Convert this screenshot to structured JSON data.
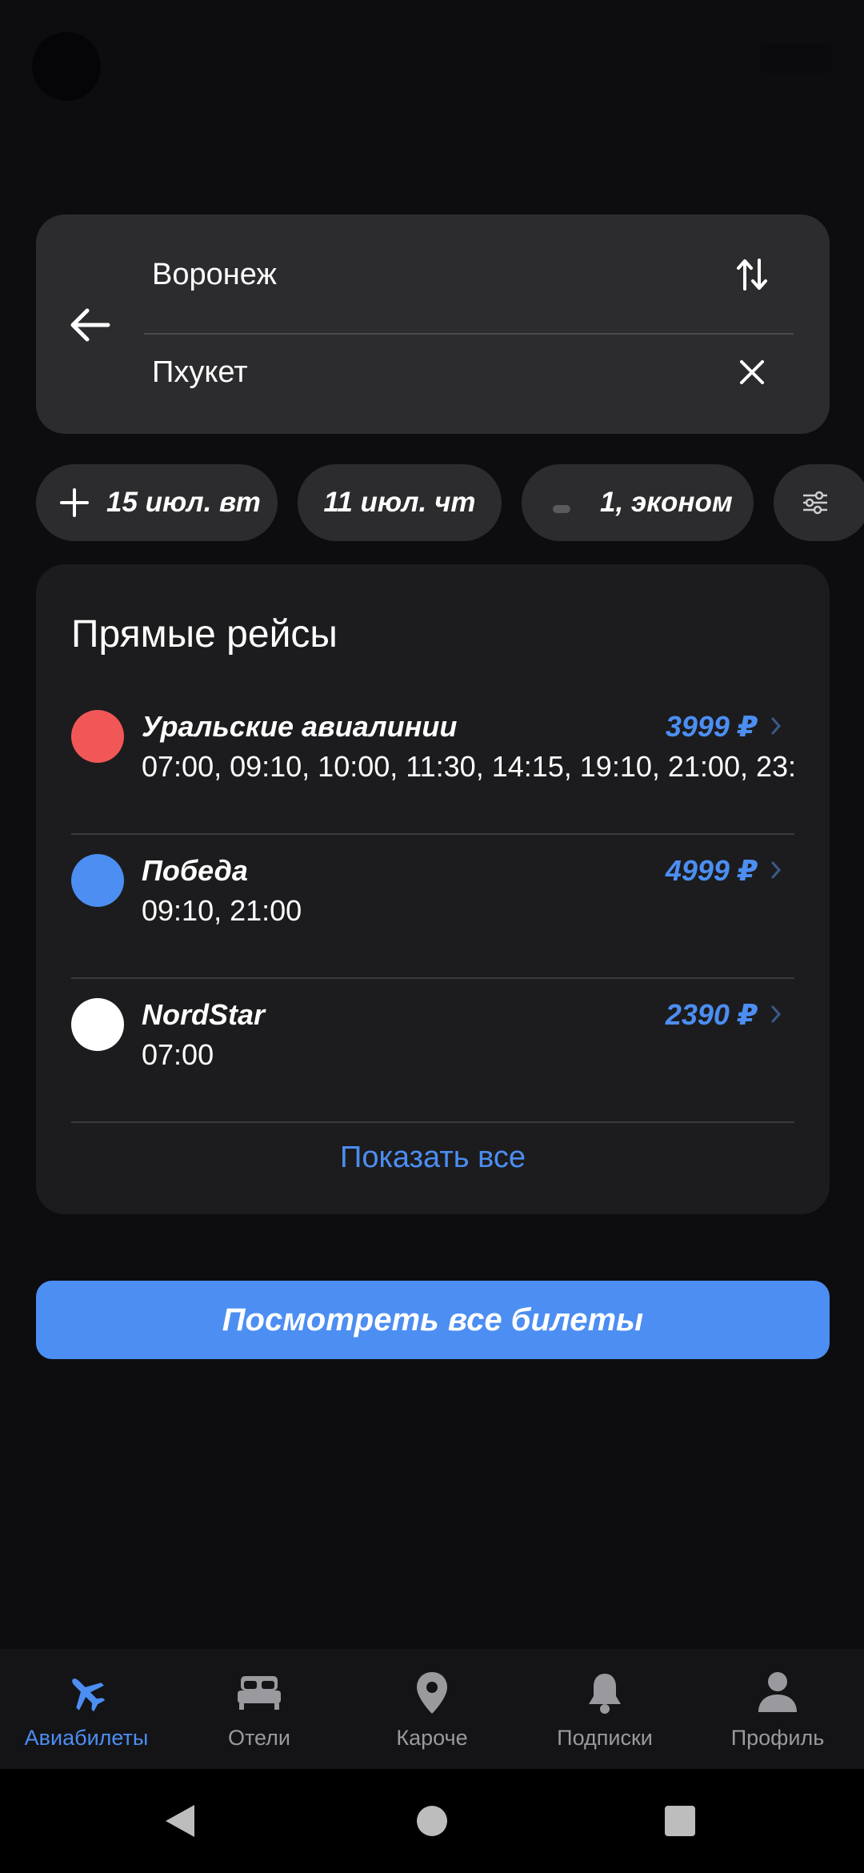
{
  "search": {
    "from": "Воронеж",
    "to": "Пхукет"
  },
  "chips": {
    "date_forward": "15 июл. вт",
    "date_return": "11 июл. чт",
    "passengers": "1, эконом"
  },
  "direct_flights": {
    "title": "Прямые рейсы",
    "rows": [
      {
        "airline": "Уральские авиалинии",
        "times": "07:00, 09:10, 10:00, 11:30, 14:15, 19:10, 21:00, 23:",
        "price": "3999 ₽",
        "color": "#f25757"
      },
      {
        "airline": "Победа",
        "times": "09:10, 21:00",
        "price": "4999 ₽",
        "color": "#4c8ef2"
      },
      {
        "airline": "NordStar",
        "times": "07:00",
        "price": "2390 ₽",
        "color": "#ffffff"
      }
    ],
    "show_all": "Показать все"
  },
  "main_button": "Посмотреть все билеты",
  "nav": {
    "items": [
      {
        "label": "Авиабилеты",
        "icon": "plane-icon",
        "active": true
      },
      {
        "label": "Отели",
        "icon": "bed-icon",
        "active": false
      },
      {
        "label": "Кароче",
        "icon": "location-pin-icon",
        "active": false
      },
      {
        "label": "Подписки",
        "icon": "bell-icon",
        "active": false
      },
      {
        "label": "Профиль",
        "icon": "profile-icon",
        "active": false
      }
    ]
  },
  "colors": {
    "accent": "#4c8ef2",
    "background": "#0d0d10",
    "card": "#2c2c2e"
  }
}
